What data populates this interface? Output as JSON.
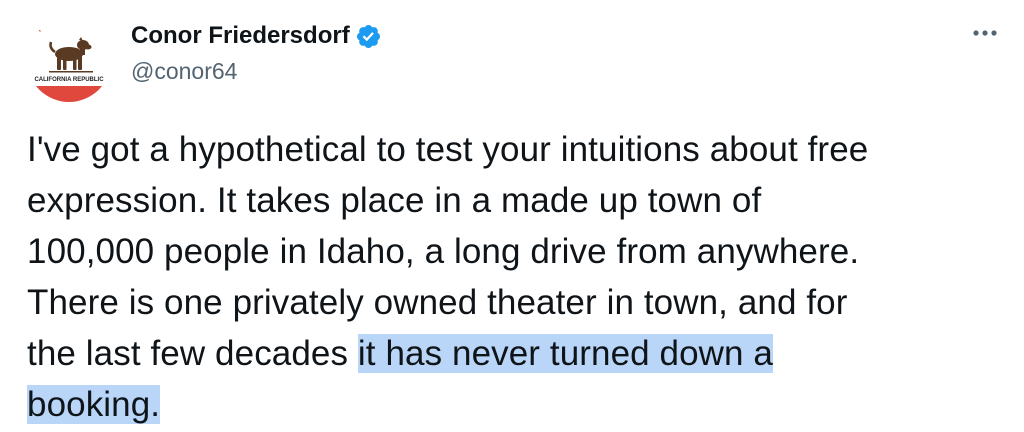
{
  "tweet": {
    "author": {
      "display_name": "Conor Friedersdorf",
      "handle": "@conor64",
      "verified": true,
      "avatar_icon": "california-republic-flag-avatar",
      "avatar_text": "CALIFORNIA REPUBLIC"
    },
    "more_icon": "more-options-icon",
    "text_lines": [
      "I've got a hypothetical to test your intuitions about free",
      "expression. It takes place in a made up town of",
      "100,000 people in Idaho, a long drive from anywhere.",
      "There is one privately owned theater in town, and for"
    ],
    "line5_plain": "the last few decades ",
    "line5_highlight": "it has never turned down a",
    "line6_highlight": "booking."
  },
  "colors": {
    "text": "#0f1419",
    "secondary": "#536471",
    "verified": "#1d9bf0",
    "highlight": "#b9d5f7",
    "flag_red": "#e0483e",
    "bear_brown": "#5a3a22"
  }
}
